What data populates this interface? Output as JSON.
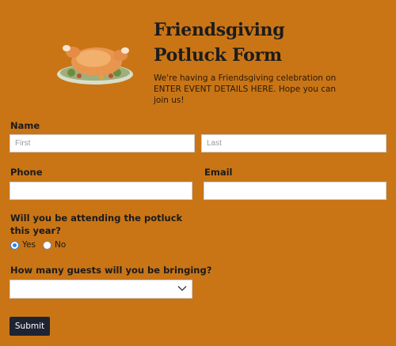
{
  "header": {
    "title": "Friendsgiving Potluck Form",
    "description": "We're having a Friendsgiving celebration on ENTER EVENT DETAILS HERE. Hope you can join us!"
  },
  "name": {
    "label": "Name",
    "first_placeholder": "First",
    "last_placeholder": "Last"
  },
  "phone": {
    "label": "Phone"
  },
  "email": {
    "label": "Email"
  },
  "attending": {
    "question": "Will you be attending the potluck this year?",
    "options": [
      {
        "label": "Yes",
        "selected": true
      },
      {
        "label": "No",
        "selected": false
      }
    ]
  },
  "guests": {
    "question": "How many guests will you be bringing?",
    "selected": ""
  },
  "submit_label": "Submit",
  "colors": {
    "background": "#c97516",
    "button": "#1f2433",
    "radio_accent": "#3c7fd6"
  }
}
